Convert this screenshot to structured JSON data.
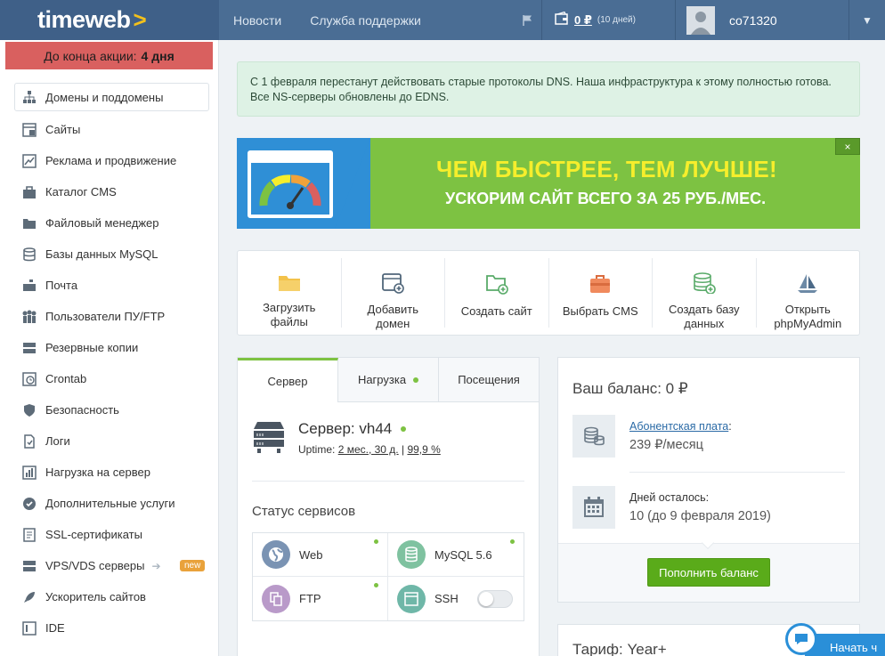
{
  "brand": {
    "name": "timeweb",
    "arrow": ">"
  },
  "topnav": {
    "news": "Новости",
    "support": "Служба поддержки"
  },
  "account": {
    "balance": "0 ₽",
    "days_note": "(10 дней)",
    "username": "co71320"
  },
  "promo": {
    "text": "До конца акции:",
    "value": "4 дня"
  },
  "sidebar": {
    "items": [
      {
        "label": "Домены и поддомены",
        "icon": "sitemap-icon"
      },
      {
        "label": "Сайты",
        "icon": "sites-icon"
      },
      {
        "label": "Реклама и продвижение",
        "icon": "chart-line-icon"
      },
      {
        "label": "Каталог CMS",
        "icon": "cms-catalog-icon"
      },
      {
        "label": "Файловый менеджер",
        "icon": "folder-icon"
      },
      {
        "label": "Базы данных MySQL",
        "icon": "database-icon"
      },
      {
        "label": "Почта",
        "icon": "mailbox-icon"
      },
      {
        "label": "Пользователи ПУ/FTP",
        "icon": "users-icon"
      },
      {
        "label": "Резервные копии",
        "icon": "backup-icon"
      },
      {
        "label": "Crontab",
        "icon": "clock-icon"
      },
      {
        "label": "Безопасность",
        "icon": "shield-icon"
      },
      {
        "label": "Логи",
        "icon": "logs-icon"
      },
      {
        "label": "Нагрузка на сервер",
        "icon": "load-icon"
      },
      {
        "label": "Дополнительные услуги",
        "icon": "services-icon"
      },
      {
        "label": "SSL-сертификаты",
        "icon": "certificate-icon"
      },
      {
        "label": "VPS/VDS серверы",
        "icon": "server-rack-icon",
        "badge": "new"
      },
      {
        "label": "Ускоритель сайтов",
        "icon": "rocket-icon"
      },
      {
        "label": "IDE",
        "icon": "ide-icon"
      }
    ]
  },
  "notice": {
    "text": "С 1 февраля перестанут действовать старые протоколы DNS. Наша инфраструктура к этому полностью готова. Все NS-серверы обновлены до EDNS."
  },
  "banner": {
    "title": "ЧЕМ БЫСТРЕЕ, ТЕМ ЛУЧШЕ!",
    "subtitle": "УСКОРИМ САЙТ ВСЕГО ЗА 25 РУБ./МЕС.",
    "close": "×"
  },
  "actions": [
    {
      "line1": "Загрузить",
      "line2": "файлы"
    },
    {
      "line1": "Добавить",
      "line2": "домен"
    },
    {
      "line1": "Создать сайт",
      "line2": ""
    },
    {
      "line1": "Выбрать CMS",
      "line2": ""
    },
    {
      "line1": "Создать базу",
      "line2": "данных"
    },
    {
      "line1": "Открыть",
      "line2": "phpMyAdmin"
    }
  ],
  "server": {
    "tabs": [
      "Сервер",
      "Нагрузка",
      "Посещения"
    ],
    "name": "Сервер: vh44",
    "uptime_label": "Uptime:",
    "uptime_value": "2 мес., 30 д.",
    "uptime_sep": "|",
    "uptime_percent": "99,9 %",
    "status_title": "Статус сервисов",
    "services": [
      {
        "name": "Web",
        "icon": "globe-icon",
        "color": "#7a93b3"
      },
      {
        "name": "MySQL 5.6",
        "icon": "database-icon",
        "color": "#7fc2a0"
      },
      {
        "name": "FTP",
        "icon": "ftp-icon",
        "color": "#b99ac9"
      },
      {
        "name": "SSH",
        "icon": "terminal-icon",
        "color": "#6fb7a8"
      }
    ]
  },
  "balance": {
    "title": "Ваш баланс: 0 ₽",
    "fee_label": "Абонентская плата",
    "fee_colon": ":",
    "fee_value": "239 ₽/месяц",
    "days_label": "Дней осталось:",
    "days_value": "10 (до 9 февраля 2019)",
    "topup": "Пополнить баланс"
  },
  "tariff": {
    "title": "Тариф: Year+"
  },
  "chat": {
    "label": "Начать ч"
  },
  "colors": {
    "accent_green": "#7dc242",
    "header_blue": "#4a6d94",
    "promo_red": "#d9605f",
    "banner_yellow": "#f6ee2c"
  }
}
